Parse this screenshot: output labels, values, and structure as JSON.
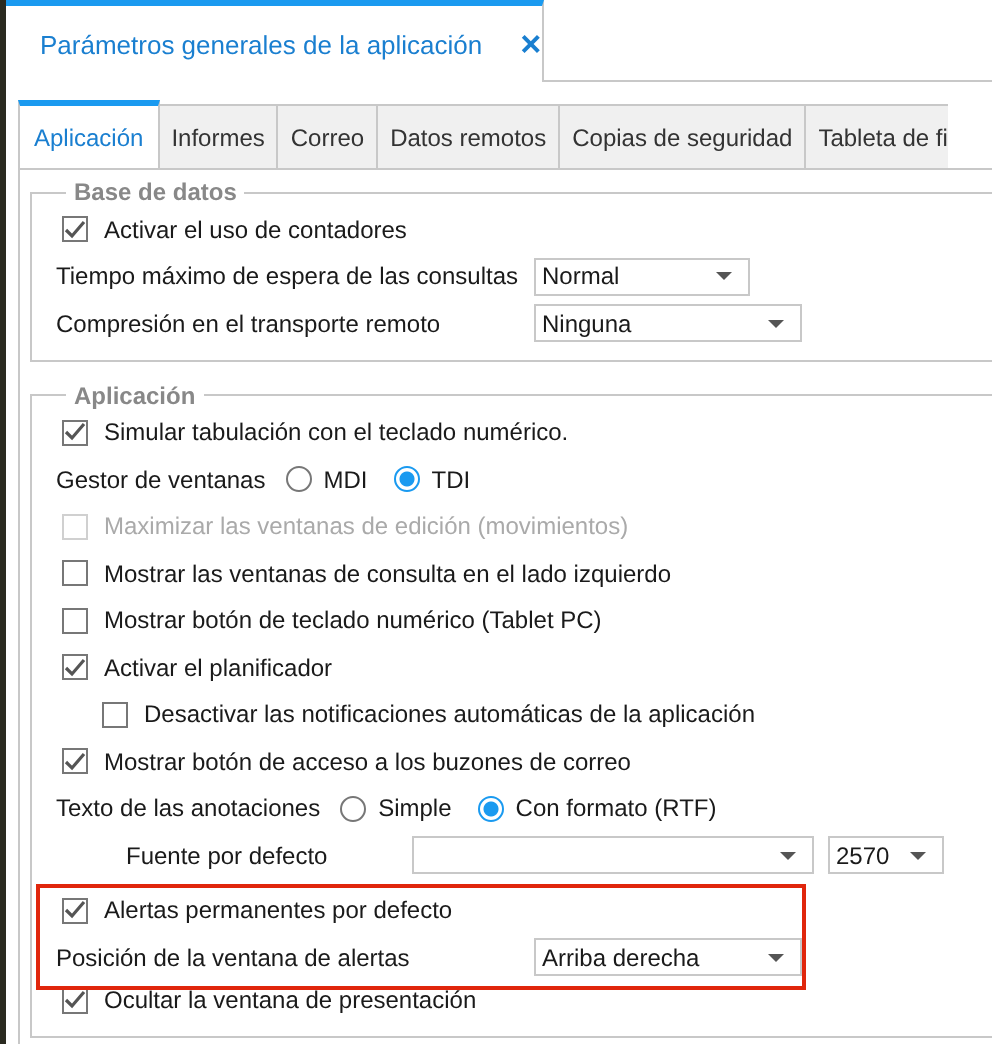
{
  "document_tab": {
    "title": "Parámetros generales de la aplicación",
    "close": "×"
  },
  "tabs": [
    {
      "label": "Aplicación",
      "selected": true
    },
    {
      "label": "Informes",
      "selected": false
    },
    {
      "label": "Correo",
      "selected": false
    },
    {
      "label": "Datos remotos",
      "selected": false
    },
    {
      "label": "Copias de seguridad",
      "selected": false
    },
    {
      "label": "Tableta de fi",
      "selected": false
    }
  ],
  "groups": [
    {
      "title": "Base de datos",
      "rows": [
        {
          "kind": "checkbox",
          "label": "Activar el uso de contadores",
          "checked": true,
          "disabled": false
        },
        {
          "kind": "dropdown",
          "label": "Tiempo máximo de espera de las consultas",
          "value": "Normal"
        },
        {
          "kind": "dropdown",
          "label": "Compresión en el transporte remoto",
          "value": "Ninguna"
        }
      ]
    },
    {
      "title": "Aplicación",
      "rows": [
        {
          "kind": "checkbox",
          "label": "Simular tabulación con el teclado numérico.",
          "checked": true,
          "disabled": false
        },
        {
          "kind": "radio",
          "label": "Gestor de ventanas",
          "options": [
            {
              "label": "MDI",
              "selected": false
            },
            {
              "label": "TDI",
              "selected": true
            }
          ]
        },
        {
          "kind": "checkbox",
          "label": "Maximizar las ventanas de edición (movimientos)",
          "checked": false,
          "disabled": true
        },
        {
          "kind": "checkbox",
          "label": "Mostrar las ventanas de consulta en el lado izquierdo",
          "checked": false,
          "disabled": false
        },
        {
          "kind": "checkbox",
          "label": "Mostrar botón de teclado numérico (Tablet PC)",
          "checked": false,
          "disabled": false
        },
        {
          "kind": "checkbox",
          "label": "Activar el planificador",
          "checked": true,
          "disabled": false,
          "children": [
            {
              "kind": "checkbox",
              "label": "Desactivar las notificaciones automáticas de la aplicación",
              "checked": false,
              "disabled": false
            }
          ]
        },
        {
          "kind": "checkbox",
          "label": "Mostrar botón de acceso a los buzones de correo",
          "checked": true,
          "disabled": false
        },
        {
          "kind": "radio",
          "label": "Texto de las anotaciones",
          "options": [
            {
              "label": "Simple",
              "selected": false
            },
            {
              "label": "Con formato (RTF)",
              "selected": true
            }
          ]
        },
        {
          "kind": "font",
          "label": "Fuente por defecto",
          "value": "",
          "size": "2570"
        },
        {
          "kind": "highlight",
          "rows": [
            {
              "kind": "checkbox",
              "label": "Alertas permanentes por defecto",
              "checked": true,
              "disabled": false
            },
            {
              "kind": "dropdown",
              "label": "Posición de la ventana de alertas",
              "value": "Arriba derecha"
            }
          ]
        },
        {
          "kind": "checkbox",
          "label": "Ocultar la ventana de presentación",
          "checked": true,
          "disabled": false
        }
      ]
    }
  ]
}
